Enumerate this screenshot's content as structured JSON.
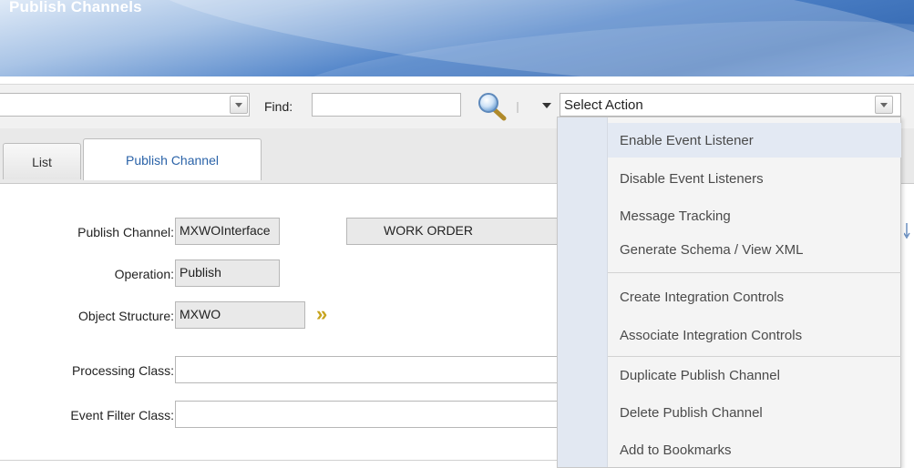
{
  "header": {
    "title": "Publish Channels"
  },
  "toolbar": {
    "find_label": "Find:",
    "find_value": "",
    "select_action_value": "Select Action"
  },
  "tabs": [
    {
      "label": "List",
      "active": false
    },
    {
      "label": "Publish Channel",
      "active": true
    }
  ],
  "form": {
    "publish_channel_label": "Publish Channel:",
    "publish_channel_value": "MXWOInterface",
    "description_value": "WORK ORDER",
    "operation_label": "Operation:",
    "operation_value": "Publish",
    "object_structure_label": "Object Structure:",
    "object_structure_value": "MXWO",
    "processing_class_label": "Processing Class:",
    "processing_class_value": "",
    "event_filter_class_label": "Event Filter Class:",
    "event_filter_class_value": ""
  },
  "action_menu": {
    "items": [
      {
        "label": "Enable Event Listener",
        "highlighted": true
      },
      {
        "label": "Disable Event Listeners"
      },
      {
        "label": "Message Tracking"
      },
      {
        "label": "Generate Schema / View XML"
      },
      {
        "label": "Create Integration Controls"
      },
      {
        "label": "Associate Integration Controls"
      },
      {
        "label": "Duplicate Publish Channel"
      },
      {
        "label": "Delete Publish Channel"
      },
      {
        "label": "Add to Bookmarks"
      }
    ]
  },
  "colors": {
    "header_blue": "#3b6fb7",
    "active_tab_text": "#2b63a8",
    "menu_highlight": "#e3e9f3"
  }
}
